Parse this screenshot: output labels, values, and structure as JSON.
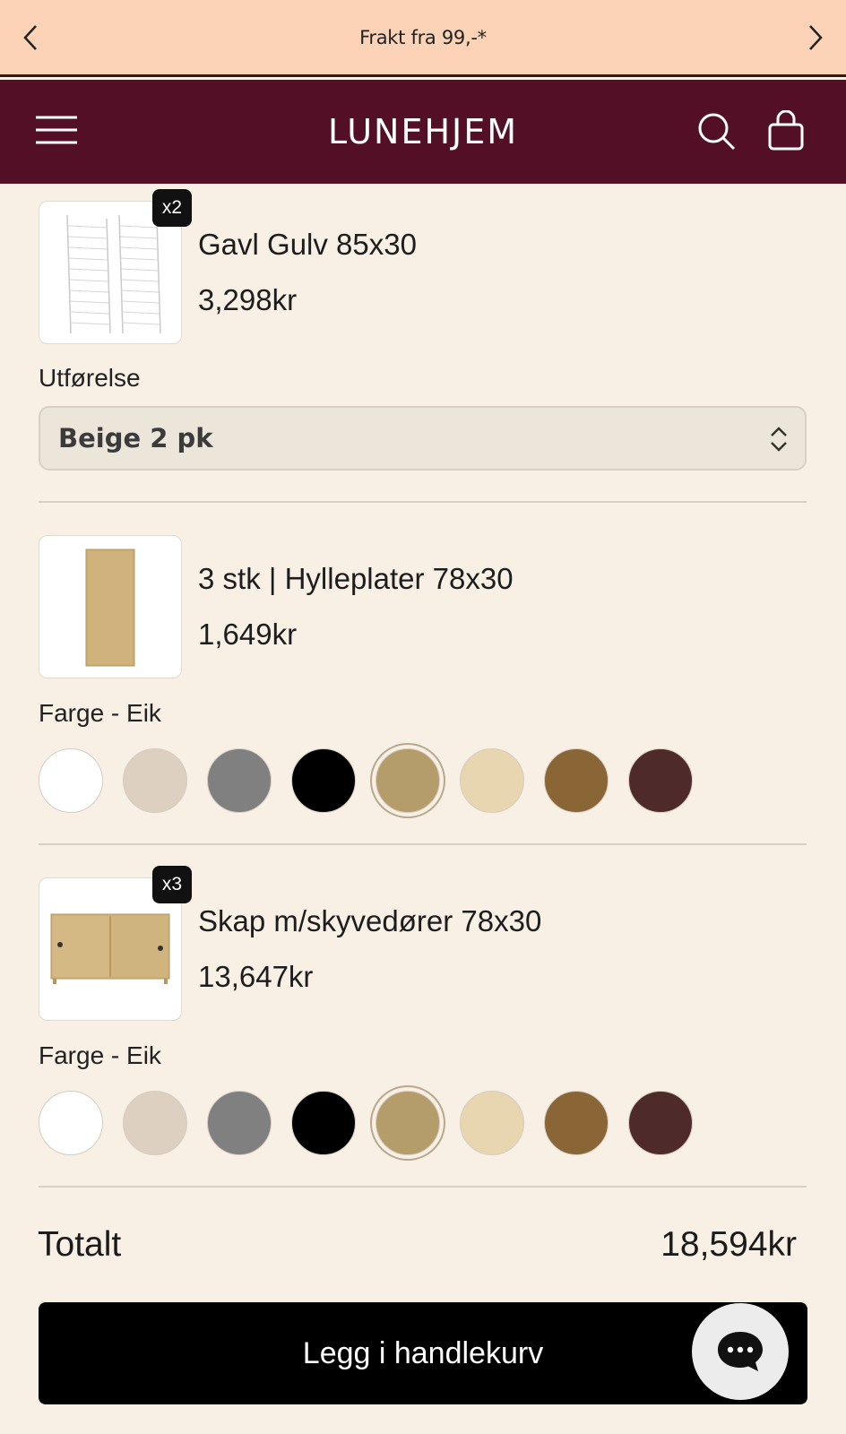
{
  "announcement": {
    "text": "Frakt fra 99,-*"
  },
  "header": {
    "logo": "LUNEHJEM"
  },
  "products": [
    {
      "qty_badge": "x2",
      "name": "Gavl Gulv 85x30",
      "price": "3,298kr",
      "option_label": "Utførelse",
      "option_value": "Beige 2 pk"
    },
    {
      "name": "3 stk | Hylleplater 78x30",
      "price": "1,649kr",
      "option_label": "Farge - Eik"
    },
    {
      "qty_badge": "x3",
      "name": "Skap m/skyvedører 78x30",
      "price": "13,647kr",
      "option_label": "Farge - Eik"
    }
  ],
  "swatch_colors": [
    "#ffffff",
    "#ddd0c0",
    "#808080",
    "#000000",
    "#b49d6b",
    "#e8d6b0",
    "#8a6535",
    "#4e2a2a"
  ],
  "selected_swatch": "#b49d6b",
  "summary": {
    "total_label": "Totalt",
    "total_value": "18,594kr"
  },
  "cta": {
    "add_to_cart": "Legg i handlekurv"
  },
  "colors": {
    "announcement_bg": "#fcd3b7",
    "header_bg": "#520f25",
    "page_bg": "#f8efe5"
  }
}
